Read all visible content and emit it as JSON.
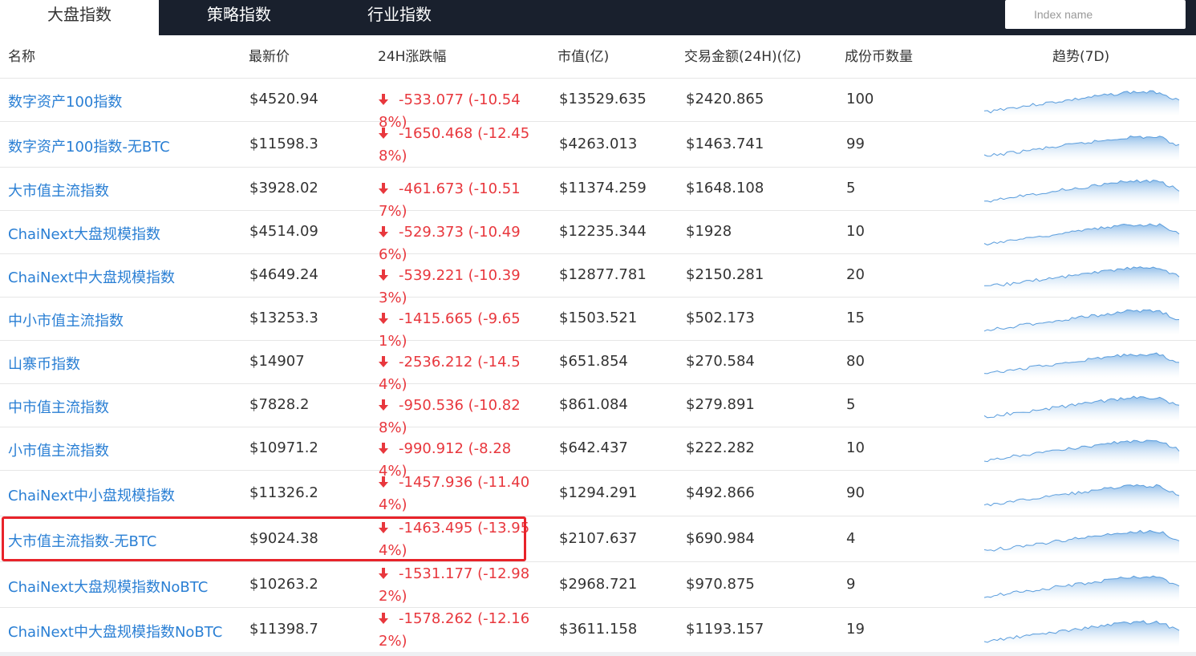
{
  "tabs": [
    "大盘指数",
    "策略指数",
    "行业指数"
  ],
  "search": {
    "placeholder": "Index name"
  },
  "headers": {
    "name": "名称",
    "price": "最新价",
    "change": "24H涨跌幅",
    "market_cap": "市值(亿)",
    "volume": "交易金额(24H)(亿)",
    "constituents": "成份币数量",
    "trend": "趋势(7D)"
  },
  "rows": [
    {
      "name": "数字资产100指数",
      "price": "$4520.94",
      "change": "-533.077 (-10.548%)",
      "market_cap": "$13529.635",
      "volume": "$2420.865",
      "count": "100"
    },
    {
      "name": "数字资产100指数-无BTC",
      "price": "$11598.3",
      "change": "-1650.468 (-12.458%)",
      "market_cap": "$4263.013",
      "volume": "$1463.741",
      "count": "99"
    },
    {
      "name": "大市值主流指数",
      "price": "$3928.02",
      "change": "-461.673 (-10.517%)",
      "market_cap": "$11374.259",
      "volume": "$1648.108",
      "count": "5"
    },
    {
      "name": "ChaiNext大盘规模指数",
      "price": "$4514.09",
      "change": "-529.373 (-10.496%)",
      "market_cap": "$12235.344",
      "volume": "$1928",
      "count": "10"
    },
    {
      "name": "ChaiNext中大盘规模指数",
      "price": "$4649.24",
      "change": "-539.221 (-10.393%)",
      "market_cap": "$12877.781",
      "volume": "$2150.281",
      "count": "20"
    },
    {
      "name": "中小市值主流指数",
      "price": "$13253.3",
      "change": "-1415.665 (-9.651%)",
      "market_cap": "$1503.521",
      "volume": "$502.173",
      "count": "15"
    },
    {
      "name": "山寨币指数",
      "price": "$14907",
      "change": "-2536.212 (-14.54%)",
      "market_cap": "$651.854",
      "volume": "$270.584",
      "count": "80"
    },
    {
      "name": "中市值主流指数",
      "price": "$7828.2",
      "change": "-950.536 (-10.828%)",
      "market_cap": "$861.084",
      "volume": "$279.891",
      "count": "5"
    },
    {
      "name": "小市值主流指数",
      "price": "$10971.2",
      "change": "-990.912 (-8.284%)",
      "market_cap": "$642.437",
      "volume": "$222.282",
      "count": "10"
    },
    {
      "name": "ChaiNext中小盘规模指数",
      "price": "$11326.2",
      "change": "-1457.936 (-11.404%)",
      "market_cap": "$1294.291",
      "volume": "$492.866",
      "count": "90"
    },
    {
      "name": "大市值主流指数-无BTC",
      "price": "$9024.38",
      "change": "-1463.495 (-13.954%)",
      "market_cap": "$2107.637",
      "volume": "$690.984",
      "count": "4"
    },
    {
      "name": "ChaiNext大盘规模指数NoBTC",
      "price": "$10263.2",
      "change": "-1531.177 (-12.982%)",
      "market_cap": "$2968.721",
      "volume": "$970.875",
      "count": "9"
    },
    {
      "name": "ChaiNext中大盘规模指数NoBTC",
      "price": "$11398.7",
      "change": "-1578.262 (-12.162%)",
      "market_cap": "$3611.158",
      "volume": "$1193.157",
      "count": "19"
    }
  ],
  "colors": {
    "nav_bg": "#19202d",
    "link": "#2a7fd4",
    "down": "#e8373d",
    "highlight_box": "#e8232a",
    "sparkline": "#7fb4e6"
  },
  "icons": {
    "change_direction": "arrow-down-icon",
    "trend": "sparkline-area-chart"
  }
}
